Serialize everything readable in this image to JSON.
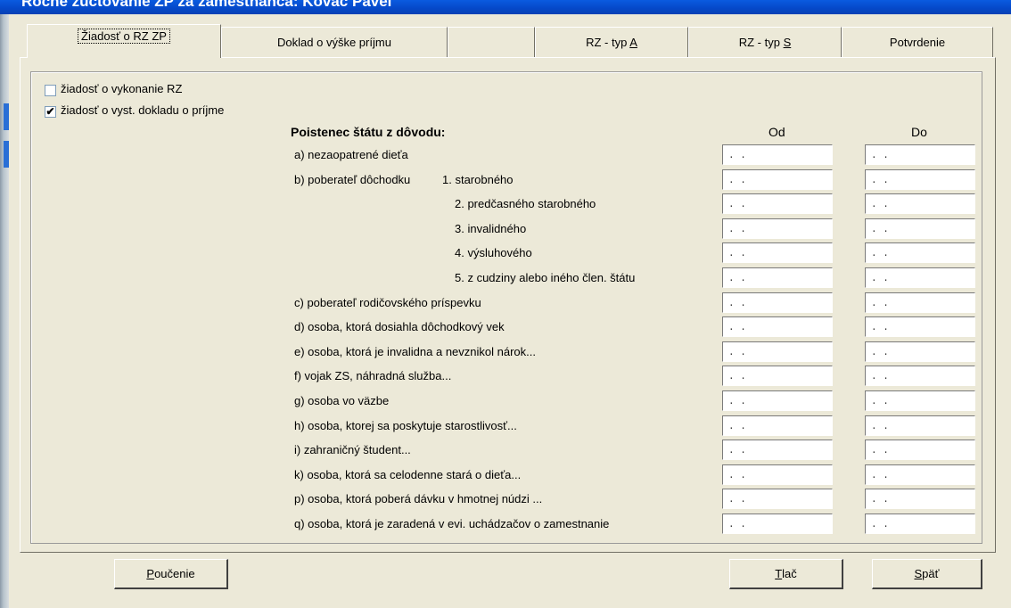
{
  "window": {
    "title": "Ročné zúčtovanie ZP za zamestnanca: Kováč Pavel"
  },
  "tabs": [
    {
      "label": "Žiadosť o RZ ZP",
      "active": true
    },
    {
      "label": "Doklad o výške príjmu"
    },
    {
      "label": ""
    },
    {
      "label_prefix": "RZ - typ ",
      "key": "A"
    },
    {
      "label_prefix": "RZ - typ ",
      "key": "S"
    },
    {
      "label": "Potvrdenie"
    }
  ],
  "checkboxes": [
    {
      "label": "žiadosť o vykonanie RZ",
      "checked": false
    },
    {
      "label": "žiadosť o vyst. dokladu o príjme",
      "checked": true
    }
  ],
  "section": {
    "heading": "Poistenec štátu z dôvodu:",
    "col_from": "Od",
    "col_to": "Do"
  },
  "rows": [
    {
      "label": "a) nezaopatrené dieťa",
      "sub": ""
    },
    {
      "label": "b) poberateľ dôchodku",
      "sub": "1. starobného"
    },
    {
      "label": "",
      "sub": "2. predčasného starobného"
    },
    {
      "label": "",
      "sub": "3. invalidného"
    },
    {
      "label": "",
      "sub": "4. výsluhového"
    },
    {
      "label": "",
      "sub": "5. z cudziny alebo iného člen. štátu"
    },
    {
      "label": "c) poberateľ rodičovského príspevku",
      "sub": ""
    },
    {
      "label": "d) osoba, ktorá dosiahla dôchodkový vek",
      "sub": ""
    },
    {
      "label": "e) osoba, ktorá je invalidna a nevznikol nárok...",
      "sub": ""
    },
    {
      "label": "f) vojak ZS, náhradná služba...",
      "sub": ""
    },
    {
      "label": "g) osoba vo väzbe",
      "sub": ""
    },
    {
      "label": "h) osoba, ktorej sa poskytuje starostlivosť...",
      "sub": ""
    },
    {
      "label": "i) zahraničný študent...",
      "sub": ""
    },
    {
      "label": "k) osoba, ktorá sa celodenne stará o dieťa...",
      "sub": ""
    },
    {
      "label": "p) osoba, ktorá poberá dávku v hmotnej núdzi ...",
      "sub": ""
    },
    {
      "label": "q) osoba, ktorá je zaradená v evi. uchádzačov o zamestnanie",
      "sub": ""
    }
  ],
  "date_placeholder": ". .",
  "buttons": {
    "info": {
      "key": "P",
      "rest": "oučenie"
    },
    "print": {
      "key": "T",
      "rest": "lač"
    },
    "back": {
      "key": "S",
      "rest": "päť"
    }
  }
}
